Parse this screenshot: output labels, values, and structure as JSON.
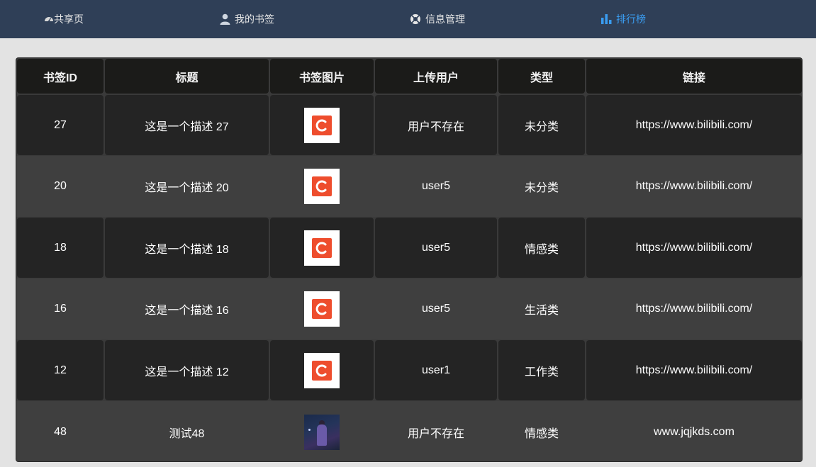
{
  "nav": [
    {
      "label": "共享页",
      "icon": "dashboard-icon",
      "active": false
    },
    {
      "label": "我的书签",
      "icon": "user-icon",
      "active": false
    },
    {
      "label": "信息管理",
      "icon": "lifebuoy-icon",
      "active": false
    },
    {
      "label": "排行榜",
      "icon": "bar-chart-icon",
      "active": true
    }
  ],
  "colors": {
    "topbar": "#2f3f57",
    "active_nav": "#3a9cf0",
    "header_cell": "#1b1b19",
    "dark_row": "#242424",
    "light_row": "#3f3f3f",
    "thumb_icon": "#ee4d2d"
  },
  "table": {
    "headers": [
      "书签ID",
      "标题",
      "书签图片",
      "上传用户",
      "类型",
      "链接"
    ],
    "rows": [
      {
        "id": "27",
        "title": "这是一个描述 27",
        "image": "c-logo-icon",
        "user": "用户不存在",
        "type": "未分类",
        "link": "https://www.bilibili.com/"
      },
      {
        "id": "20",
        "title": "这是一个描述 20",
        "image": "c-logo-icon",
        "user": "user5",
        "type": "未分类",
        "link": "https://www.bilibili.com/"
      },
      {
        "id": "18",
        "title": "这是一个描述 18",
        "image": "c-logo-icon",
        "user": "user5",
        "type": "情感类",
        "link": "https://www.bilibili.com/"
      },
      {
        "id": "16",
        "title": "这是一个描述 16",
        "image": "c-logo-icon",
        "user": "user5",
        "type": "生活类",
        "link": "https://www.bilibili.com/"
      },
      {
        "id": "12",
        "title": "这是一个描述 12",
        "image": "c-logo-icon",
        "user": "user1",
        "type": "工作类",
        "link": "https://www.bilibili.com/"
      },
      {
        "id": "48",
        "title": "测试48",
        "image": "photo-thumbnail",
        "user": "用户不存在",
        "type": "情感类",
        "link": "www.jqjkds.com"
      }
    ]
  }
}
